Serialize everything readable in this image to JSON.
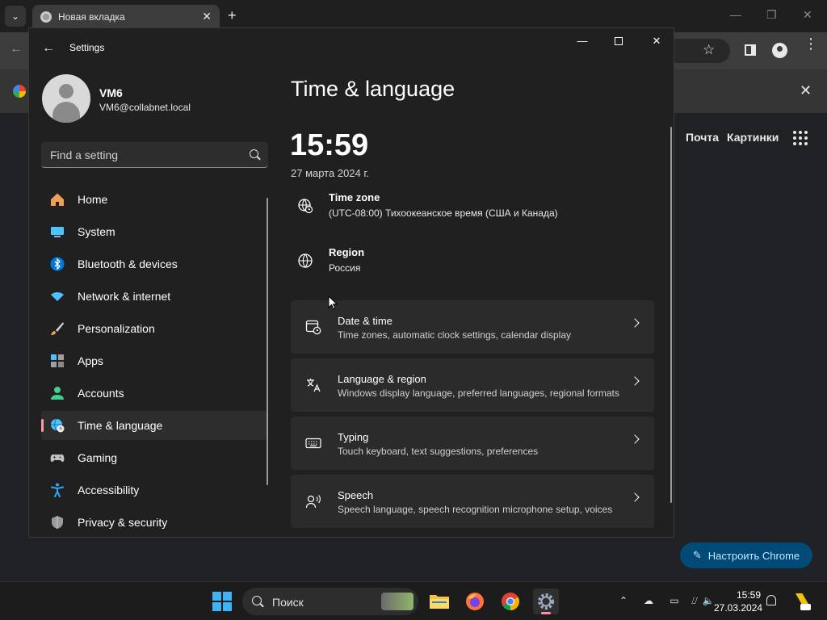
{
  "browser": {
    "tab_title": "Новая вкладка",
    "links": [
      "Почта",
      "Картинки"
    ],
    "customize_button": "Настроить Chrome"
  },
  "settings": {
    "window_title": "Settings",
    "user": {
      "name": "VM6",
      "email": "VM6@collabnet.local"
    },
    "search_placeholder": "Find a setting",
    "nav": [
      {
        "label": "Home",
        "icon": "home-icon",
        "color": "#f0a050"
      },
      {
        "label": "System",
        "icon": "system-icon",
        "color": "#4cc2ff"
      },
      {
        "label": "Bluetooth & devices",
        "icon": "bluetooth-icon",
        "color": "#0078d4"
      },
      {
        "label": "Network & internet",
        "icon": "wifi-icon",
        "color": "#4cc2ff"
      },
      {
        "label": "Personalization",
        "icon": "brush-icon",
        "color": "#f7a14b"
      },
      {
        "label": "Apps",
        "icon": "apps-icon",
        "color": "#a0a0a0"
      },
      {
        "label": "Accounts",
        "icon": "person-icon",
        "color": "#3fcf8e"
      },
      {
        "label": "Time & language",
        "icon": "globe-clock-icon",
        "color": "#4cc2ff",
        "active": true
      },
      {
        "label": "Gaming",
        "icon": "gamepad-icon",
        "color": "#c0c0c0"
      },
      {
        "label": "Accessibility",
        "icon": "accessibility-icon",
        "color": "#2aa7f0"
      },
      {
        "label": "Privacy & security",
        "icon": "shield-icon",
        "color": "#9a9a9a"
      }
    ],
    "page": {
      "title": "Time & language",
      "time": "15:59",
      "date": "27 марта 2024 г.",
      "info": [
        {
          "title": "Time zone",
          "value": "(UTC-08:00) Тихоокеанское время (США и Канада)",
          "icon": "timezone-icon"
        },
        {
          "title": "Region",
          "value": "Россия",
          "icon": "globe-icon"
        }
      ],
      "cards": [
        {
          "title": "Date & time",
          "subtitle": "Time zones, automatic clock settings, calendar display",
          "icon": "calendar-clock-icon"
        },
        {
          "title": "Language & region",
          "subtitle": "Windows display language, preferred languages, regional formats",
          "icon": "language-icon"
        },
        {
          "title": "Typing",
          "subtitle": "Touch keyboard, text suggestions, preferences",
          "icon": "keyboard-icon"
        },
        {
          "title": "Speech",
          "subtitle": "Speech language, speech recognition microphone setup, voices",
          "icon": "speech-icon"
        }
      ]
    }
  },
  "taskbar": {
    "search_label": "Поиск",
    "clock_time": "15:59",
    "clock_date": "27.03.2024"
  }
}
